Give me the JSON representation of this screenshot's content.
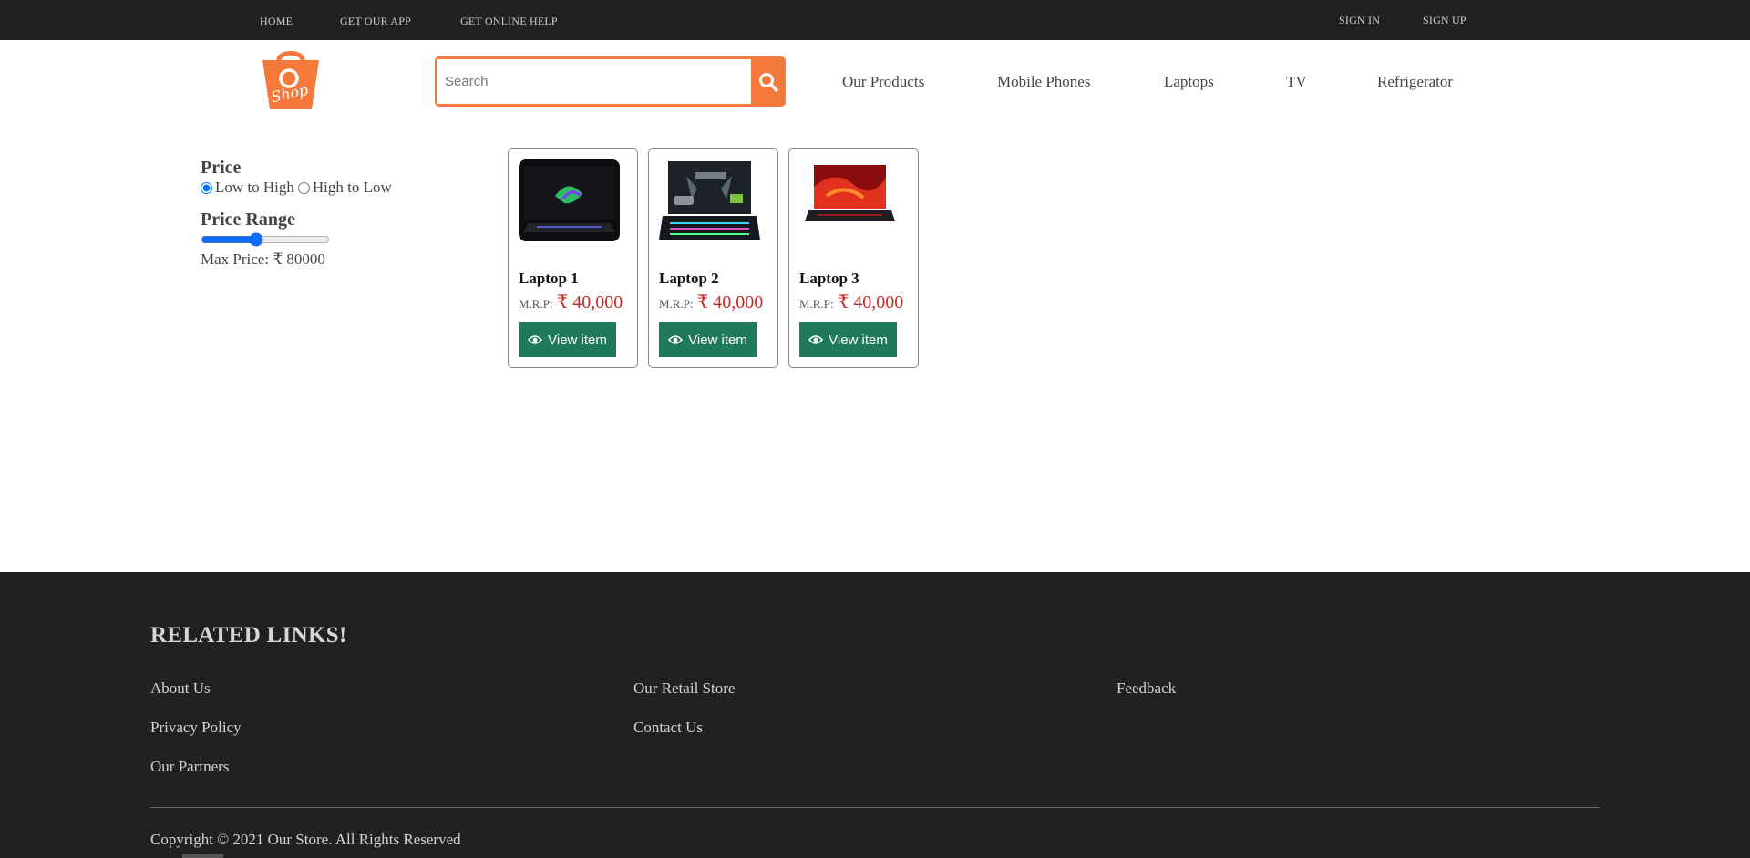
{
  "topbar": {
    "left_links": [
      "HOME",
      "GET OUR APP",
      "GET ONLINE HELP"
    ],
    "right_links": [
      "SIGN IN",
      "SIGN UP"
    ]
  },
  "header": {
    "logo_text": "Shop",
    "logo_color": "#f5793a",
    "search": {
      "placeholder": "Search",
      "value": ""
    },
    "nav": [
      "Our Products",
      "Mobile Phones",
      "Laptops",
      "TV",
      "Refrigerator"
    ]
  },
  "filters": {
    "price_title": "Price",
    "sort_options": [
      {
        "label": "Low to High",
        "checked": true
      },
      {
        "label": "High to Low",
        "checked": false
      }
    ],
    "range_title": "Price Range",
    "range_value_fraction": 0.42,
    "max_price_label": "Max Price: ₹ 80000"
  },
  "products": [
    {
      "name": "Laptop 1",
      "mrp_label": "M.R.P:",
      "price": "₹ 40,000",
      "button": "View item"
    },
    {
      "name": "Laptop 2",
      "mrp_label": "M.R.P:",
      "price": "₹ 40,000",
      "button": "View item"
    },
    {
      "name": "Laptop 3",
      "mrp_label": "M.R.P:",
      "price": "₹ 40,000",
      "button": "View item"
    }
  ],
  "footer": {
    "heading": "RELATED LINKS!",
    "links": {
      "col1": [
        "About Us",
        "Privacy Policy",
        "Our Partners"
      ],
      "col2": [
        "Our Retail Store",
        "Contact Us"
      ],
      "col3": [
        "Feedback"
      ]
    },
    "copyright": "Copyright © 2021 Our Store. All Rights Reserved"
  },
  "colors": {
    "topbar_bg": "#212121",
    "accent_orange": "#f5793a",
    "price_red": "#c7281f",
    "button_green": "#1f7a5a",
    "footer_bg": "#212121"
  }
}
